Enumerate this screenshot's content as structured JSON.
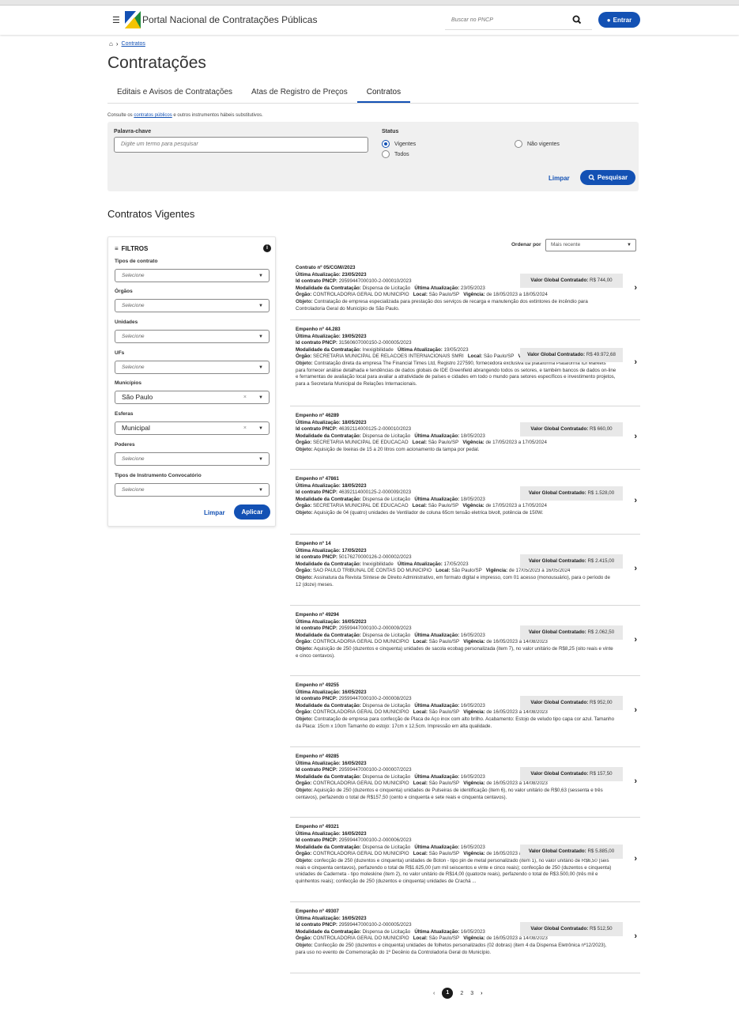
{
  "header": {
    "portal_title": "Portal Nacional de Contratações Públicas",
    "search_placeholder": "Buscar no PNCP",
    "login_label": "Entrar"
  },
  "breadcrumb": {
    "current": "Contratos"
  },
  "page_title": "Contratações",
  "tabs": [
    {
      "label": "Editais e Avisos de Contratações",
      "active": false
    },
    {
      "label": "Atas de Registro de Preços",
      "active": false
    },
    {
      "label": "Contratos",
      "active": true
    }
  ],
  "consult": {
    "prefix": "Consulte os ",
    "link": "contratos públicos",
    "suffix": " e outros instrumentos hábeis substitutivos."
  },
  "search": {
    "keyword_label": "Palavra-chave",
    "keyword_placeholder": "Digite um termo para pesquisar",
    "status_label": "Status",
    "status_options": [
      {
        "label": "Vigentes",
        "checked": true
      },
      {
        "label": "Não vigentes",
        "checked": false
      },
      {
        "label": "Todos",
        "checked": false
      }
    ],
    "clear_label": "Limpar",
    "search_label": "Pesquisar"
  },
  "section_title": "Contratos Vigentes",
  "filters": {
    "title": "FILTROS",
    "groups": [
      {
        "label": "Tipos de contrato",
        "value": "Selecione",
        "filled": false
      },
      {
        "label": "Órgãos",
        "value": "Selecione",
        "filled": false
      },
      {
        "label": "Unidades",
        "value": "Selecione",
        "filled": false
      },
      {
        "label": "UFs",
        "value": "Selecione",
        "filled": false
      },
      {
        "label": "Municípios",
        "value": "São Paulo",
        "filled": true
      },
      {
        "label": "Esferas",
        "value": "Municipal",
        "filled": true
      },
      {
        "label": "Poderes",
        "value": "Selecione",
        "filled": false
      },
      {
        "label": "Tipos de Instrumento Convocatório",
        "value": "Selecione",
        "filled": false
      }
    ],
    "clear_label": "Limpar",
    "apply_label": "Aplicar"
  },
  "order": {
    "label": "Ordenar por",
    "value": "Mais recente"
  },
  "labels": {
    "ultima": "Última Atualização",
    "id": "Id contrato PNCP",
    "modalidade": "Modalidade da Contratação",
    "orgao": "Órgão",
    "local": "Local",
    "vigencia": "Vigência",
    "objeto": "Objeto",
    "valor": "Valor Global Contratado"
  },
  "results": [
    {
      "title": "Contrato nº 05/CGM//2023",
      "updated": "23/05/2023",
      "id": "29599447000100-2-000010/2023",
      "modalidade": "Dispensa de Licitação",
      "updated2": "23/05/2023",
      "orgao": "CONTROLADORIA GERAL DO MUNICIPIO",
      "local": "São Paulo/SP",
      "vigencia": "de 18/05/2023 a 18/05/2024",
      "objeto": "Contratação de empresa especializada para prestação dos serviços de recarga e manutenção dos extintores de incêndio para Controladoria Geral do Município de São Paulo.",
      "valor": "R$ 744,00",
      "h": 78
    },
    {
      "title": "Empenho nº 44.283",
      "updated": "19/05/2023",
      "id": "31560607000150-2-000005/2023",
      "modalidade": "Inexigibilidade",
      "updated2": "19/05/2023",
      "orgao": "SECRETARIA MUNICIPAL DE RELACOES INTERNACIONAIS SMRI",
      "local": "São Paulo/SP",
      "vigencia": "de 09/05/2023 a 09/05/2024",
      "objeto": "Contratação direta da empresa The Financial Times Ltd, Registro 227590, fornecedora exclusiva da plataforma Plataforma fDi Markets para fornecer análise detalhada e tendências de dados globais de IDE Greenfield abrangendo todos os setores, e também bancos de dados on-line e ferramentas de avaliação local para avaliar a atratividade de países e cidades em todo o mundo para setores específicos e investimento projetos, para a Secretaria Municipal de Relações Internacionais.",
      "valor": "R$ 49.972,68",
      "h": 109
    },
    {
      "title": "Empenho nº 46289",
      "updated": "18/05/2023",
      "id": "46392114000125-2-000010/2023",
      "modalidade": "Dispensa de Licitação",
      "updated2": "18/05/2023",
      "orgao": "SECRETARIA MUNICIPAL DE EDUCACAO",
      "local": "São Paulo/SP",
      "vigencia": "de 17/05/2023 a 17/05/2024",
      "objeto": "Aquisição de lixeiras de 15 a 20 litros com acionamento da tampa por pedal.",
      "valor": "R$ 660,00",
      "h": 80
    },
    {
      "title": "Empenho nº 47861",
      "updated": "18/05/2023",
      "id": "46392114000125-2-000009/2023",
      "modalidade": "Dispensa de Licitação",
      "updated2": "18/05/2023",
      "orgao": "SECRETARIA MUNICIPAL DE EDUCACAO",
      "local": "São Paulo/SP",
      "vigencia": "de 17/05/2023 a 17/05/2024",
      "objeto": "Aquisição de 04 (quatro) unidades de Ventilador de coluna 65cm tensão eletrica bivolt, potência de 150W.",
      "valor": "R$ 1.528,00",
      "h": 82
    },
    {
      "title": "Empenho nº 14",
      "updated": "17/05/2023",
      "id": "50176270000126-2-000002/2023",
      "modalidade": "Inexigibilidade",
      "updated2": "17/05/2023",
      "orgao": "SAO PAULO TRIBUNAL DE CONTAS DO MUNICIPIO",
      "local": "São Paulo/SP",
      "vigencia": "de 17/05/2023 a 16/05/2024",
      "objeto": "Assinatura da Revista Síntese de Direito Administrativo, em formato digital e impresso, com 01 acesso (monousuário), para o período de 12 (doze) meses.",
      "valor": "R$ 2.415,00",
      "h": 90
    },
    {
      "title": "Empenho nº 49294",
      "updated": "16/05/2023",
      "id": "29599447000100-2-000009/2023",
      "modalidade": "Dispensa de Licitação",
      "updated2": "16/05/2023",
      "orgao": "CONTROLADORIA GERAL DO MUNICIPIO",
      "local": "São Paulo/SP",
      "vigencia": "de 16/05/2023 a 14/08/2023",
      "objeto": "Aquisição de 250 (duzentos e cinquenta) unidades de sacola ecobag personalizada (item 7), no valor unitário de R$8,25 (oito reais e vinte e cinco centavos).",
      "valor": "R$ 2.062,50",
      "h": 89
    },
    {
      "title": "Empenho nº 49255",
      "updated": "16/05/2023",
      "id": "29599447000100-2-000008/2023",
      "modalidade": "Dispensa de Licitação",
      "updated2": "16/05/2023",
      "orgao": "CONTROLADORIA GERAL DO MUNICIPIO",
      "local": "São Paulo/SP",
      "vigencia": "de 16/05/2023 a 14/08/2023",
      "objeto": "Contratação de empresa para confecção de Placa de Aço inox com alto brilho. Acabamento: Estojo de veludo tipo capa cor azul. Tamanho da Placa: 15cm x 10cm Tamanho do estojo: 17cm x 12,5cm. Impressão em alta qualidade.",
      "valor": "R$ 952,00",
      "h": 90
    },
    {
      "title": "Empenho nº 49285",
      "updated": "16/05/2023",
      "id": "29599447000100-2-000007/2023",
      "modalidade": "Dispensa de Licitação",
      "updated2": "16/05/2023",
      "orgao": "CONTROLADORIA GERAL DO MUNICIPIO",
      "local": "São Paulo/SP",
      "vigencia": "de 16/05/2023 a 14/08/2023",
      "objeto": "Aquisição de 250 (duzentos e cinquenta) unidades de Pulseiras de identificação (item 6), no valor unitário de R$0,63 (sessenta e três centavos), perfazendo o total de R$157,50 (cento e cinquenta e sete reais e cinquenta centavos).",
      "valor": "R$ 157,50",
      "h": 89
    },
    {
      "title": "Empenho nº 49321",
      "updated": "16/05/2023",
      "id": "29599447000100-2-000006/2023",
      "modalidade": "Dispensa de Licitação",
      "updated2": "16/05/2023",
      "orgao": "CONTROLADORIA GERAL DO MUNICIPIO",
      "local": "São Paulo/SP",
      "vigencia": "de 16/05/2023 a 14/08/2023",
      "objeto": "confecção de 250 (duzentos e cinquenta) unidades de Boton - tipo pin de metal personalizado (item 1), no valor unitário de R$6,50 (seis reais e cinquenta centavos), perfazendo o total de R$1.625,00 (um mil seiscentos e vinte e cinco reais); confecção de 250 (duzentos e cinquenta) unidades de Caderneta - tipo moleskine (item 2), no valor unitário de R$14,00 (quatorze reais), perfazendo o total de R$3.500,00 (três mil e quinhentos reais); confecção de 250 (duzentos e cinquenta) unidades de Crachá ...",
      "valor": "R$ 5.885,00",
      "h": 107
    },
    {
      "title": "Empenho nº 49307",
      "updated": "16/05/2023",
      "id": "29599447000100-2-000005/2023",
      "modalidade": "Dispensa de Licitação",
      "updated2": "16/05/2023",
      "orgao": "CONTROLADORIA GERAL DO MUNICIPIO",
      "local": "São Paulo/SP",
      "vigencia": "de 16/05/2023 a 14/08/2023",
      "objeto": "Confecção de 250 (duzentos e cinquenta) unidades de folhetos personalizados (02 dobras) (item 4 da Dispensa Eletrônica nº12/2023), para uso no evento de Comemoração do 1º Decênio da Controladoria Geral do Município.",
      "valor": "R$ 512,50",
      "h": 90
    }
  ],
  "pagination": {
    "prev": "‹",
    "pages": [
      "1",
      "2",
      "3"
    ],
    "current": "1",
    "next": "›"
  }
}
